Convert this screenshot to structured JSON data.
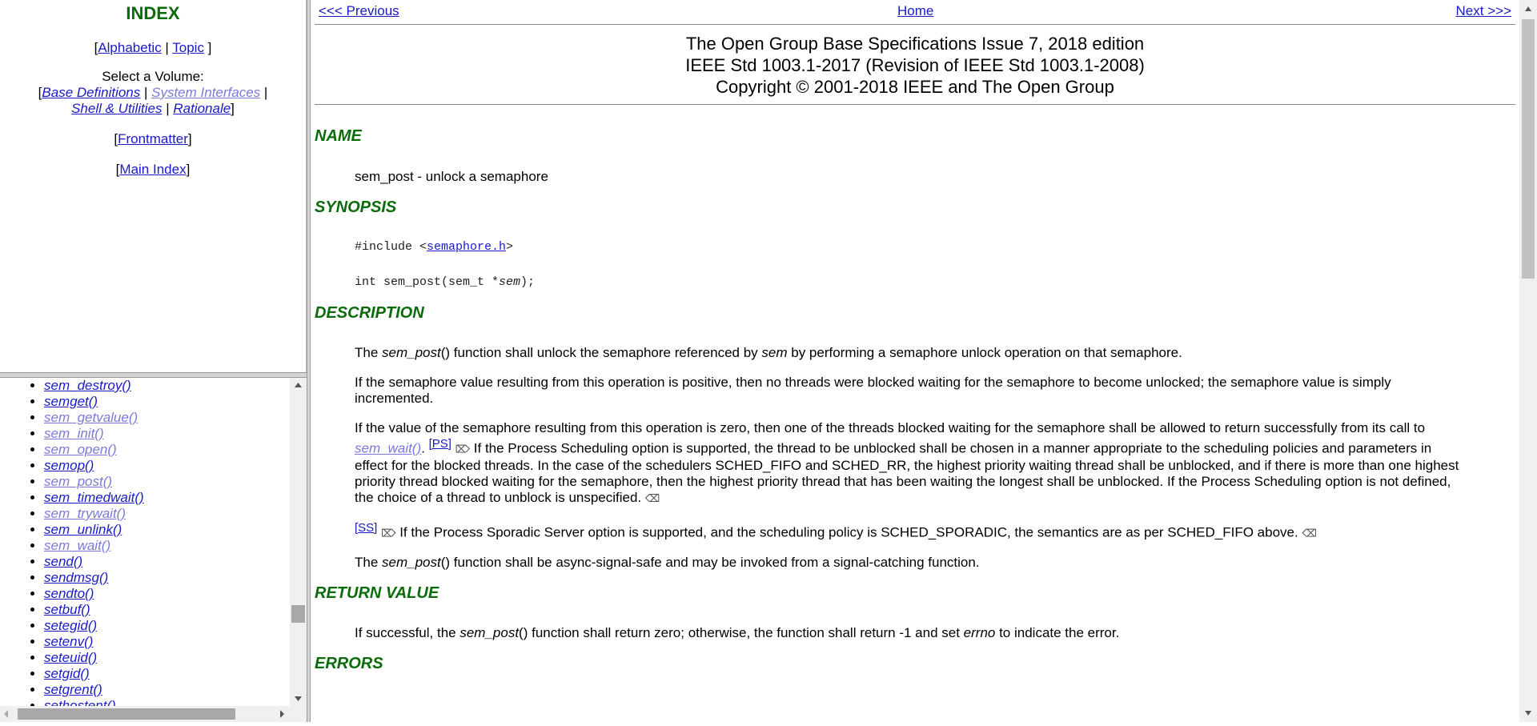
{
  "left_top": {
    "title": "INDEX",
    "alphabetic": "Alphabetic",
    "topic": "Topic",
    "select_volume": "Select a Volume:",
    "base_definitions": "Base Definitions",
    "system_interfaces": "System Interfaces",
    "shell_utilities": "Shell & Utilities",
    "rationale": "Rationale",
    "frontmatter": "Frontmatter",
    "main_index": "Main Index"
  },
  "function_list": [
    {
      "label": "sem_destroy()",
      "visited": false
    },
    {
      "label": "semget()",
      "visited": false
    },
    {
      "label": "sem_getvalue()",
      "visited": true
    },
    {
      "label": "sem_init()",
      "visited": true
    },
    {
      "label": "sem_open()",
      "visited": true
    },
    {
      "label": "semop()",
      "visited": false
    },
    {
      "label": "sem_post()",
      "visited": true
    },
    {
      "label": "sem_timedwait()",
      "visited": false
    },
    {
      "label": "sem_trywait()",
      "visited": true
    },
    {
      "label": "sem_unlink()",
      "visited": false
    },
    {
      "label": "sem_wait()",
      "visited": true
    },
    {
      "label": "send()",
      "visited": false
    },
    {
      "label": "sendmsg()",
      "visited": false
    },
    {
      "label": "sendto()",
      "visited": false
    },
    {
      "label": "setbuf()",
      "visited": false
    },
    {
      "label": "setegid()",
      "visited": false
    },
    {
      "label": "setenv()",
      "visited": false
    },
    {
      "label": "seteuid()",
      "visited": false
    },
    {
      "label": "setgid()",
      "visited": false
    },
    {
      "label": "setgrent()",
      "visited": false
    },
    {
      "label": "sethostent()",
      "visited": false
    }
  ],
  "nav": {
    "previous": "<<< Previous",
    "home": "Home",
    "next": "Next >>>"
  },
  "banner": {
    "line1": "The Open Group Base Specifications Issue 7, 2018 edition",
    "line2": "IEEE Std 1003.1-2017 (Revision of IEEE Std 1003.1-2008)",
    "line3": "Copyright © 2001-2018 IEEE and The Open Group"
  },
  "sections": {
    "name": {
      "heading": "NAME",
      "text": "sem_post - unlock a semaphore"
    },
    "synopsis": {
      "heading": "SYNOPSIS",
      "include_prefix": "#include <",
      "include_header": "semaphore.h",
      "include_suffix": ">",
      "proto_prefix": "int sem_post(sem_t *",
      "proto_arg": "sem",
      "proto_suffix": ");"
    },
    "description": {
      "heading": "DESCRIPTION",
      "p1_a": "The ",
      "p1_func": "sem_post",
      "p1_b": "() function shall unlock the semaphore referenced by ",
      "p1_arg": "sem",
      "p1_c": " by performing a semaphore unlock operation on that semaphore.",
      "p2": "If the semaphore value resulting from this operation is positive, then no threads were blocked waiting for the semaphore to become unlocked; the semaphore value is simply incremented.",
      "p3_a": "If the value of the semaphore resulting from this operation is zero, then one of the threads blocked waiting for the semaphore shall be allowed to return successfully from its call to ",
      "p3_link": "sem_wait()",
      "p3_b": ". ",
      "p3_ps": "[PS]",
      "p3_c": " If the Process Scheduling option is supported, the thread to be unblocked shall be chosen in a manner appropriate to the scheduling policies and parameters in effect for the blocked threads. In the case of the schedulers SCHED_FIFO and SCHED_RR, the highest priority waiting thread shall be unblocked, and if there is more than one highest priority thread blocked waiting for the semaphore, then the highest priority thread that has been waiting the longest shall be unblocked. If the Process Scheduling option is not defined, the choice of a thread to unblock is unspecified.",
      "p4_ss": "[SS]",
      "p4_text": " If the Process Sporadic Server option is supported, and the scheduling policy is SCHED_SPORADIC, the semantics are as per SCHED_FIFO above.",
      "p5_a": "The ",
      "p5_func": "sem_post",
      "p5_b": "() function shall be async-signal-safe and may be invoked from a signal-catching function."
    },
    "return_value": {
      "heading": "RETURN VALUE",
      "a": "If successful, the ",
      "func": "sem_post",
      "b": "() function shall return zero; otherwise, the function shall return -1 and set ",
      "errno": "errno",
      "c": " to indicate the error."
    },
    "errors": {
      "heading": "ERRORS"
    }
  },
  "icons": {
    "option_start": "option-start-icon",
    "option_end": "option-end-icon"
  }
}
